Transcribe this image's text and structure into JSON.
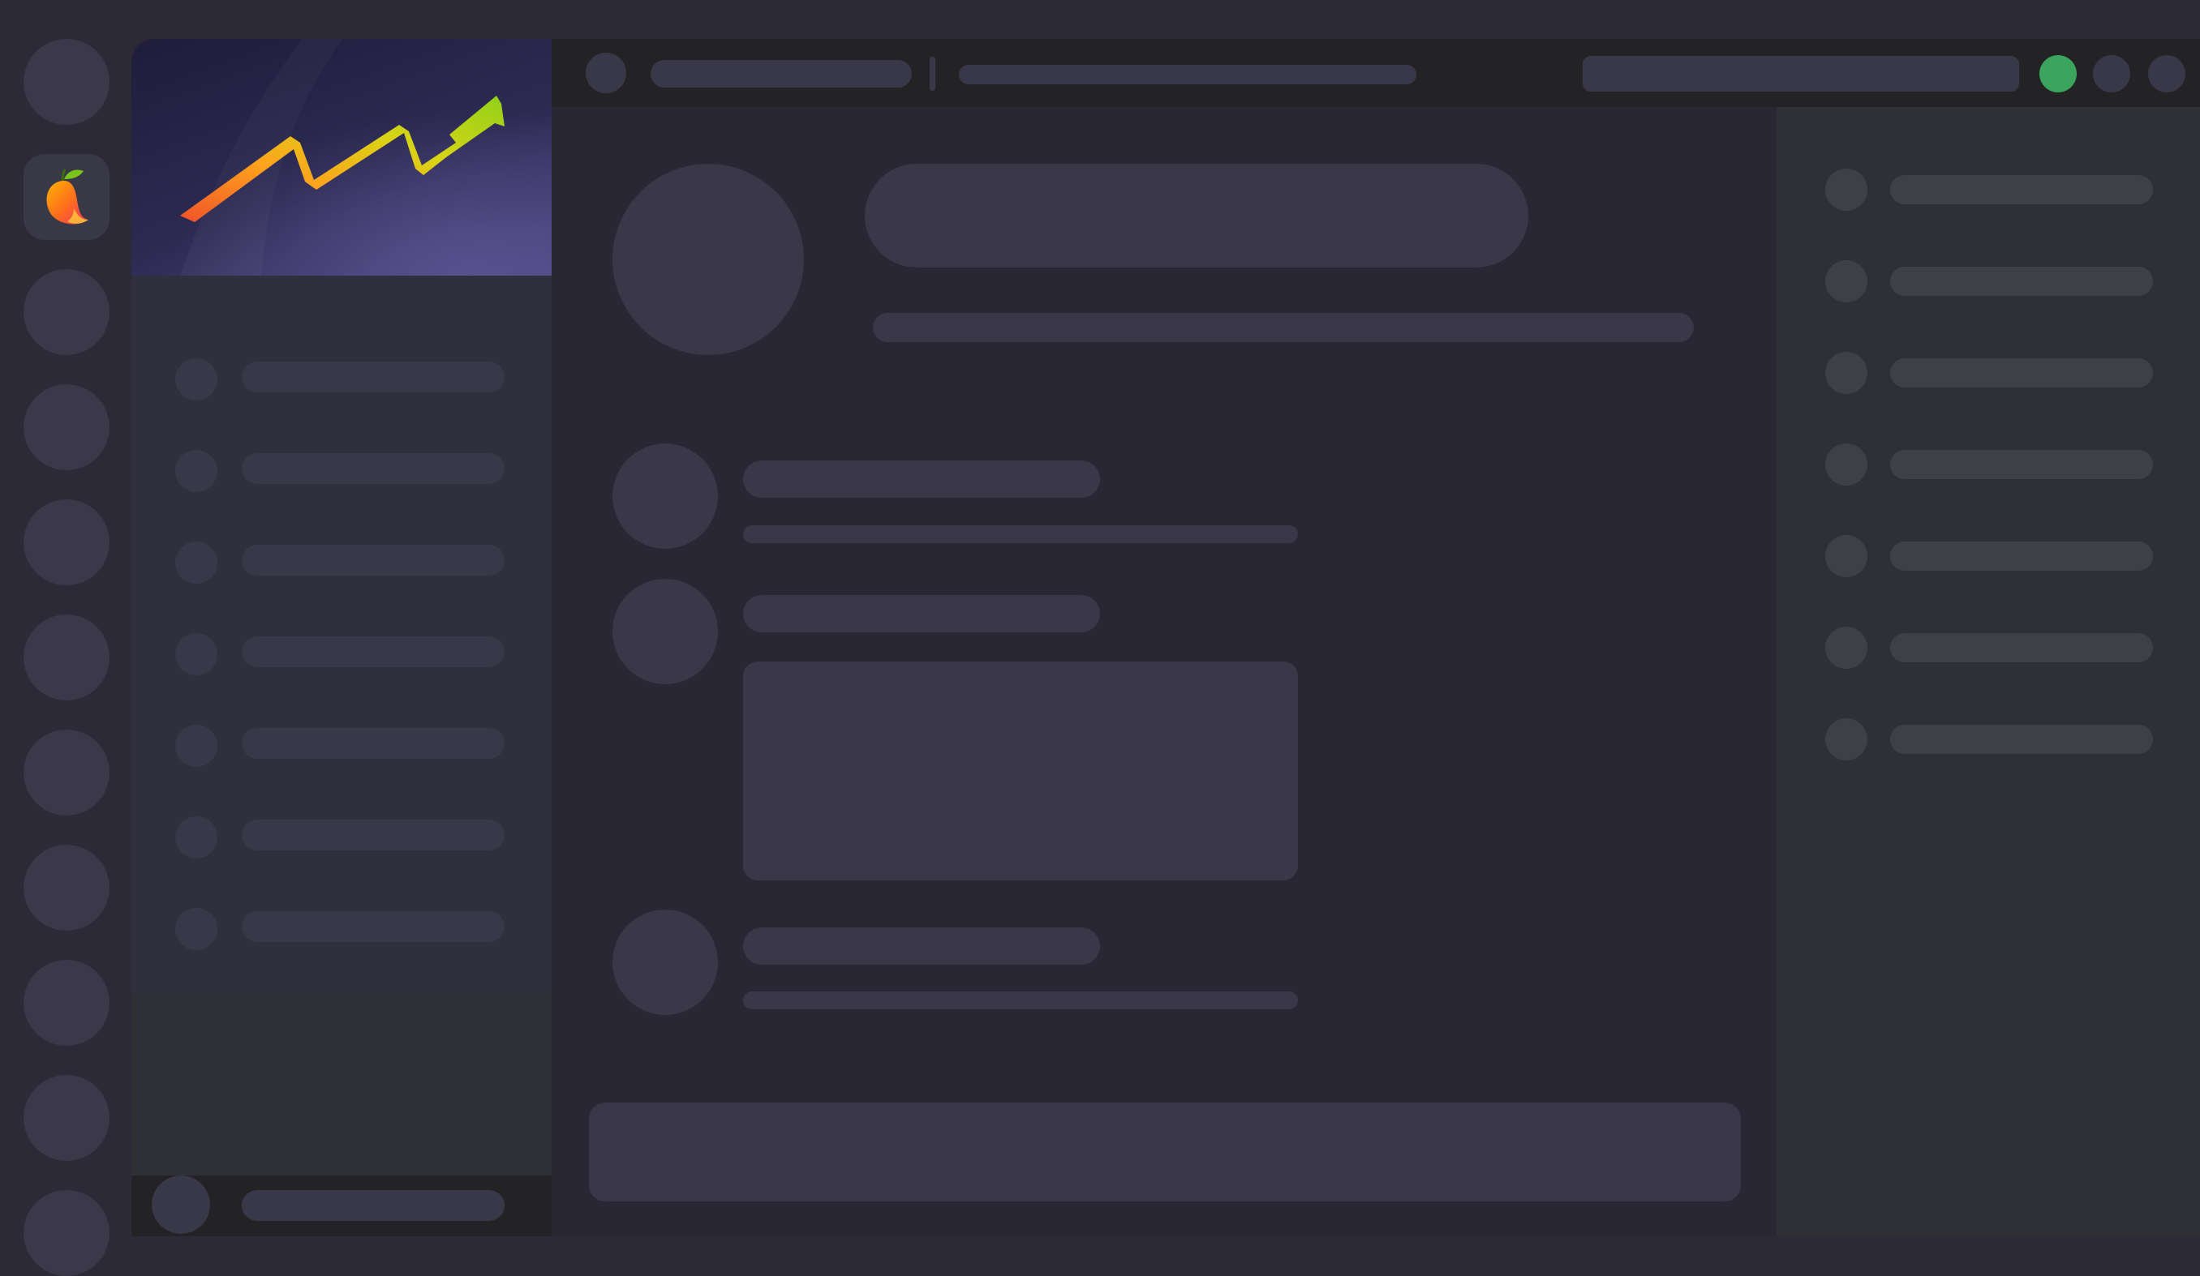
{
  "app": {
    "logo": "mango-logo",
    "banner_art": "trending-up-arrow"
  },
  "rail": {
    "server_count": 12,
    "active_index": 1
  },
  "sidebar": {
    "channel_count": 7
  },
  "header": {
    "status_color": "#3ba55d"
  },
  "members": {
    "count": 7
  },
  "colors": {
    "background": "#2b2a36",
    "sidebar": "#302f3d",
    "header": "#232326",
    "main": "#282733",
    "members": "#2f3035",
    "skeleton": "#393748",
    "online": "#3ba55d"
  }
}
